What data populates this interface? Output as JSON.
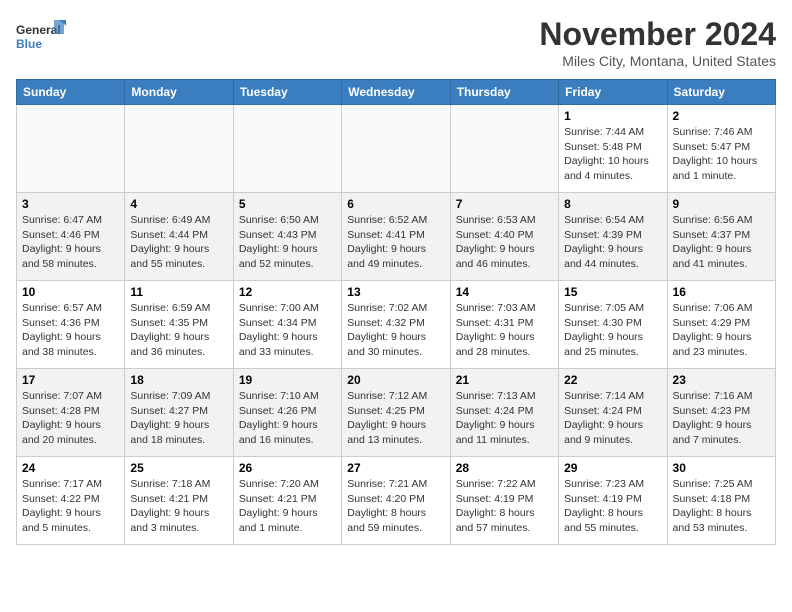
{
  "header": {
    "logo_line1": "General",
    "logo_line2": "Blue",
    "month_title": "November 2024",
    "location": "Miles City, Montana, United States"
  },
  "days_of_week": [
    "Sunday",
    "Monday",
    "Tuesday",
    "Wednesday",
    "Thursday",
    "Friday",
    "Saturday"
  ],
  "weeks": [
    [
      {
        "day": "",
        "info": "",
        "empty": true
      },
      {
        "day": "",
        "info": "",
        "empty": true
      },
      {
        "day": "",
        "info": "",
        "empty": true
      },
      {
        "day": "",
        "info": "",
        "empty": true
      },
      {
        "day": "",
        "info": "",
        "empty": true
      },
      {
        "day": "1",
        "info": "Sunrise: 7:44 AM\nSunset: 5:48 PM\nDaylight: 10 hours and 4 minutes."
      },
      {
        "day": "2",
        "info": "Sunrise: 7:46 AM\nSunset: 5:47 PM\nDaylight: 10 hours and 1 minute."
      }
    ],
    [
      {
        "day": "3",
        "info": "Sunrise: 6:47 AM\nSunset: 4:46 PM\nDaylight: 9 hours and 58 minutes."
      },
      {
        "day": "4",
        "info": "Sunrise: 6:49 AM\nSunset: 4:44 PM\nDaylight: 9 hours and 55 minutes."
      },
      {
        "day": "5",
        "info": "Sunrise: 6:50 AM\nSunset: 4:43 PM\nDaylight: 9 hours and 52 minutes."
      },
      {
        "day": "6",
        "info": "Sunrise: 6:52 AM\nSunset: 4:41 PM\nDaylight: 9 hours and 49 minutes."
      },
      {
        "day": "7",
        "info": "Sunrise: 6:53 AM\nSunset: 4:40 PM\nDaylight: 9 hours and 46 minutes."
      },
      {
        "day": "8",
        "info": "Sunrise: 6:54 AM\nSunset: 4:39 PM\nDaylight: 9 hours and 44 minutes."
      },
      {
        "day": "9",
        "info": "Sunrise: 6:56 AM\nSunset: 4:37 PM\nDaylight: 9 hours and 41 minutes."
      }
    ],
    [
      {
        "day": "10",
        "info": "Sunrise: 6:57 AM\nSunset: 4:36 PM\nDaylight: 9 hours and 38 minutes."
      },
      {
        "day": "11",
        "info": "Sunrise: 6:59 AM\nSunset: 4:35 PM\nDaylight: 9 hours and 36 minutes."
      },
      {
        "day": "12",
        "info": "Sunrise: 7:00 AM\nSunset: 4:34 PM\nDaylight: 9 hours and 33 minutes."
      },
      {
        "day": "13",
        "info": "Sunrise: 7:02 AM\nSunset: 4:32 PM\nDaylight: 9 hours and 30 minutes."
      },
      {
        "day": "14",
        "info": "Sunrise: 7:03 AM\nSunset: 4:31 PM\nDaylight: 9 hours and 28 minutes."
      },
      {
        "day": "15",
        "info": "Sunrise: 7:05 AM\nSunset: 4:30 PM\nDaylight: 9 hours and 25 minutes."
      },
      {
        "day": "16",
        "info": "Sunrise: 7:06 AM\nSunset: 4:29 PM\nDaylight: 9 hours and 23 minutes."
      }
    ],
    [
      {
        "day": "17",
        "info": "Sunrise: 7:07 AM\nSunset: 4:28 PM\nDaylight: 9 hours and 20 minutes."
      },
      {
        "day": "18",
        "info": "Sunrise: 7:09 AM\nSunset: 4:27 PM\nDaylight: 9 hours and 18 minutes."
      },
      {
        "day": "19",
        "info": "Sunrise: 7:10 AM\nSunset: 4:26 PM\nDaylight: 9 hours and 16 minutes."
      },
      {
        "day": "20",
        "info": "Sunrise: 7:12 AM\nSunset: 4:25 PM\nDaylight: 9 hours and 13 minutes."
      },
      {
        "day": "21",
        "info": "Sunrise: 7:13 AM\nSunset: 4:24 PM\nDaylight: 9 hours and 11 minutes."
      },
      {
        "day": "22",
        "info": "Sunrise: 7:14 AM\nSunset: 4:24 PM\nDaylight: 9 hours and 9 minutes."
      },
      {
        "day": "23",
        "info": "Sunrise: 7:16 AM\nSunset: 4:23 PM\nDaylight: 9 hours and 7 minutes."
      }
    ],
    [
      {
        "day": "24",
        "info": "Sunrise: 7:17 AM\nSunset: 4:22 PM\nDaylight: 9 hours and 5 minutes."
      },
      {
        "day": "25",
        "info": "Sunrise: 7:18 AM\nSunset: 4:21 PM\nDaylight: 9 hours and 3 minutes."
      },
      {
        "day": "26",
        "info": "Sunrise: 7:20 AM\nSunset: 4:21 PM\nDaylight: 9 hours and 1 minute."
      },
      {
        "day": "27",
        "info": "Sunrise: 7:21 AM\nSunset: 4:20 PM\nDaylight: 8 hours and 59 minutes."
      },
      {
        "day": "28",
        "info": "Sunrise: 7:22 AM\nSunset: 4:19 PM\nDaylight: 8 hours and 57 minutes."
      },
      {
        "day": "29",
        "info": "Sunrise: 7:23 AM\nSunset: 4:19 PM\nDaylight: 8 hours and 55 minutes."
      },
      {
        "day": "30",
        "info": "Sunrise: 7:25 AM\nSunset: 4:18 PM\nDaylight: 8 hours and 53 minutes."
      }
    ]
  ]
}
